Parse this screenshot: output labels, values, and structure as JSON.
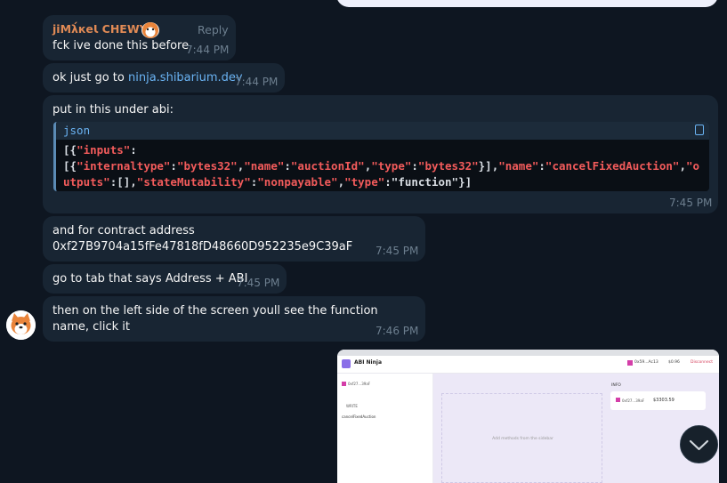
{
  "messages": {
    "m1": {
      "sender": "jiMλ́кeƖ CHEWY",
      "reply_label": "Reply",
      "text": "fck ive done this before",
      "time": "7:44 PM"
    },
    "m2": {
      "text_prefix": "ok just go to ",
      "link": "ninja.shibarium.dev",
      "time": "7:44 PM"
    },
    "m3": {
      "text": "put in this under abi:",
      "code_lang": "json",
      "time": "7:45 PM"
    },
    "m4": {
      "line1": "and for contract address",
      "line2": "0xf27B9704a15fFe47818fD48660D952235e9C39aF",
      "time": "7:45 PM"
    },
    "m5": {
      "text": "go to tab that says Address + ABI",
      "time": "7:45 PM"
    },
    "m6": {
      "text": "then on the left side of the screen youll see the function name, click it",
      "time": "7:46 PM"
    }
  },
  "code": {
    "t1": "[{",
    "t2": "\"inputs\"",
    "t3": ":",
    "t4": "[{",
    "t5": "\"internaltype\"",
    "t6": ":",
    "t7": "\"bytes32\"",
    "t8": ",",
    "t9": "\"name\"",
    "t10": ":",
    "t11": "\"auctionId\"",
    "t12": ",",
    "t13": "\"type\"",
    "t14": ":",
    "t15": "\"bytes32\"",
    "t16": "}],",
    "t17": "\"name\"",
    "t18": ":",
    "t19": "\"cancelFixedAuction\"",
    "t20": ",",
    "t21": "\"outputs\"",
    "t22": ":",
    "t23": "[],",
    "t24": "\"stateMutability\"",
    "t25": ":",
    "t26": "\"nonpayable\"",
    "t27": ",",
    "t28": "\"type\"",
    "t29": ":",
    "t30": "\"function\"",
    "t31": "}]"
  },
  "screenshot": {
    "brand": "ABI Ninja",
    "wallet": "0x59...Ac13",
    "balance": "$0.96",
    "disconnect": "Disconnect",
    "address": "0xf27...39aF",
    "section": "WRITE",
    "function": "cancelFixedAuction",
    "placeholder": "Add methods from the sidebar",
    "info_label": "INFO",
    "info_address": "0xf27...39aF",
    "info_value": "$3303.59"
  },
  "colors": {
    "bg": "#0e1621",
    "bubble": "#182533",
    "link": "#6ab3f3",
    "code_key": "#f25b5b",
    "sender": "#e08a55"
  }
}
